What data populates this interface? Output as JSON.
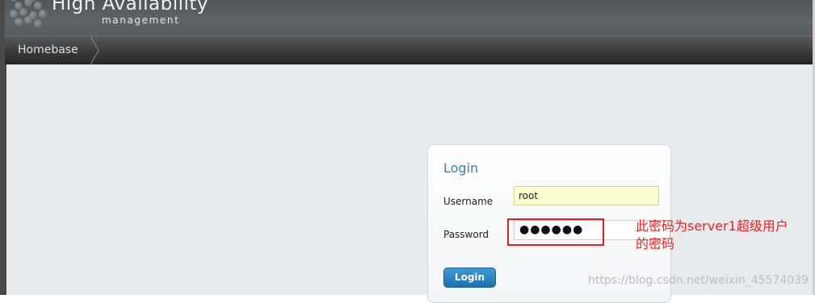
{
  "header": {
    "logo_title": "High Availability",
    "logo_subtitle": "management"
  },
  "breadcrumb": {
    "items": [
      {
        "label": "Homebase"
      }
    ]
  },
  "login": {
    "title": "Login",
    "username_label": "Username",
    "username_value": "root",
    "password_label": "Password",
    "password_value": "●●●●●●",
    "button_label": "Login"
  },
  "annotation": {
    "note": "此密码为server1超级用户的密码",
    "color": "#ff1a1a"
  },
  "watermark": {
    "text": "https://blog.csdn.net/weixin_45574039"
  },
  "colors": {
    "accent": "#2e86bd",
    "button": "#1d6fad",
    "username_field_bg": "#fefbd0"
  }
}
